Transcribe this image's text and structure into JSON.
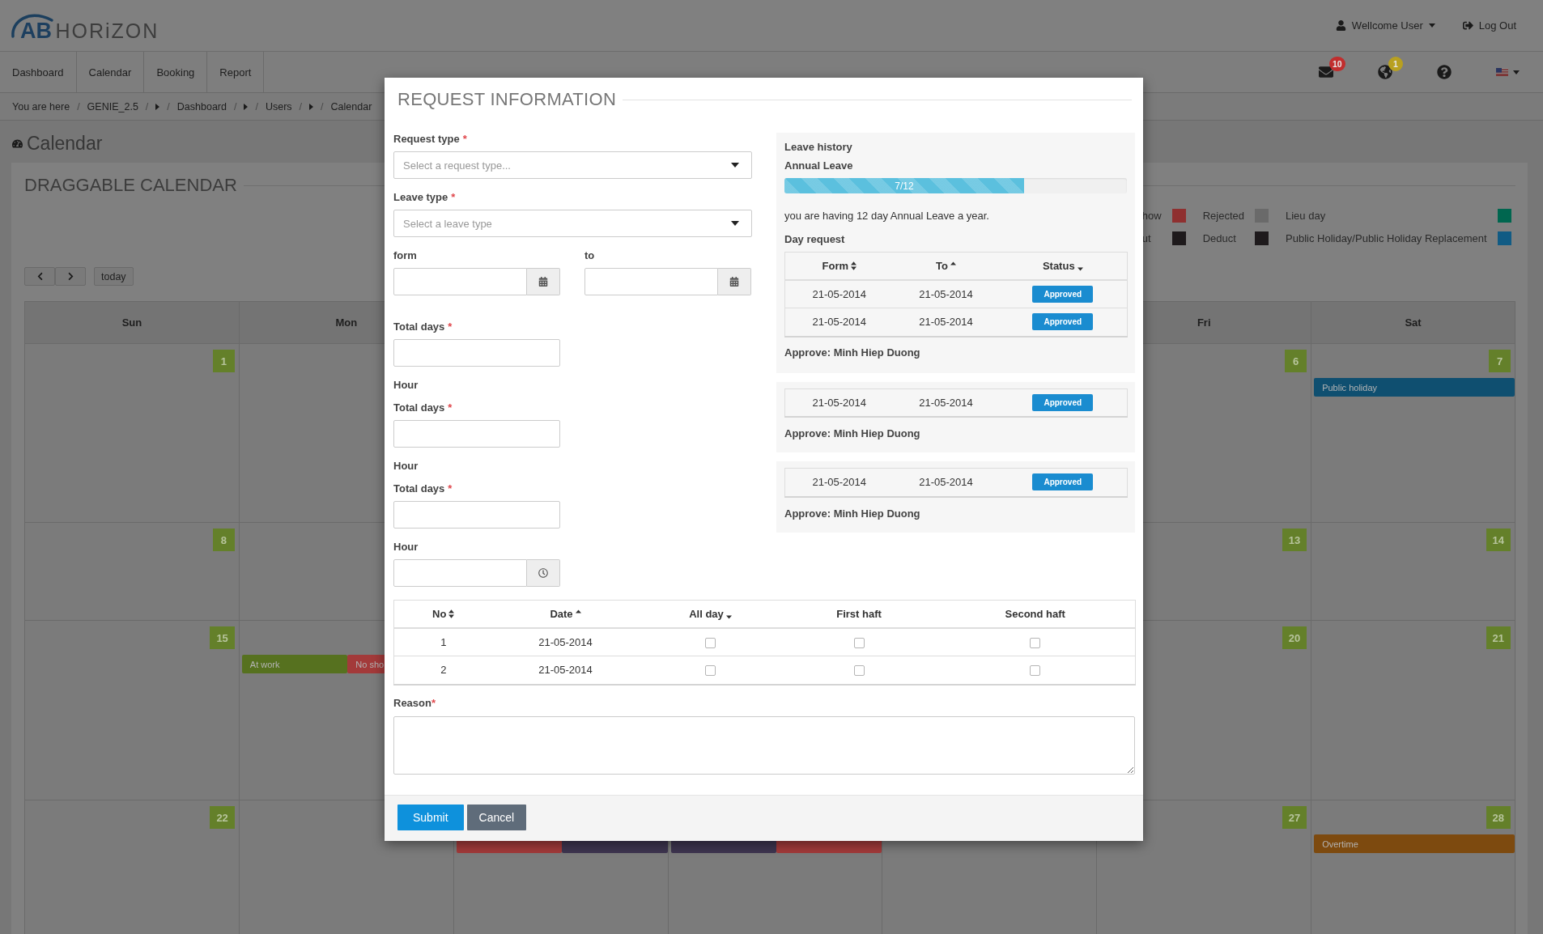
{
  "header": {
    "logo": {
      "mark": "AB",
      "name": "HORiZON"
    },
    "user_menu": "Wellcome User",
    "logout": "Log Out"
  },
  "nav": {
    "tabs": [
      {
        "label": "Dashboard",
        "selected": false
      },
      {
        "label": "Calendar",
        "selected": false
      },
      {
        "label": "Booking",
        "selected": false
      },
      {
        "label": "Report",
        "selected": false
      }
    ],
    "icons": [
      {
        "kind": "mail",
        "badge": "10",
        "color": "#c12e2e"
      },
      {
        "kind": "globe",
        "badge": "1",
        "color": "#b8a020"
      },
      {
        "kind": "help"
      },
      {
        "kind": "flag"
      }
    ]
  },
  "breadcrumb": [
    {
      "kind": "text",
      "text": "You are here"
    },
    {
      "kind": "separator",
      "text": "/"
    },
    {
      "kind": "link",
      "text": "GENIE_2.5"
    },
    {
      "kind": "separator",
      "text": "/"
    },
    {
      "kind": "caret"
    },
    {
      "kind": "separator",
      "text": "/"
    },
    {
      "kind": "link",
      "text": "Dashboard"
    },
    {
      "kind": "separator",
      "text": "/"
    },
    {
      "kind": "caret"
    },
    {
      "kind": "separator",
      "text": "/"
    },
    {
      "kind": "link",
      "text": "Users"
    },
    {
      "kind": "separator",
      "text": "/"
    },
    {
      "kind": "caret"
    },
    {
      "kind": "separator",
      "text": "/"
    },
    {
      "kind": "link",
      "text": "Calendar"
    }
  ],
  "page_title": "Calendar",
  "calendar": {
    "title": "DRAGGABLE CALENDAR",
    "legend": [
      {
        "label": "how",
        "color": "#8f3030"
      },
      {
        "label": "Rejected",
        "color": "#6a6a6a"
      },
      {
        "label": "Lieu day",
        "color": "#00664f"
      },
      {
        "label": "ut",
        "color": "#1e1a1c"
      },
      {
        "label": "Deduct",
        "color": "#1e1a1c"
      },
      {
        "label": "Public Holiday/Public Holiday Replacement",
        "color": "#115b84"
      }
    ],
    "today_button": "today",
    "weekdays": {
      "sun": "Sun",
      "mon": "Mon",
      "fri": "Fri",
      "sat": "Sat"
    },
    "weeks": [
      {
        "sun": {
          "day": "1"
        },
        "fri": {
          "day": "6"
        },
        "sat": {
          "day": "7",
          "events": [
            {
              "label": "Public holiday",
              "color": "#0f4f70"
            }
          ]
        }
      },
      {
        "sun": {
          "day": "8"
        },
        "fri": {
          "day": "13"
        },
        "sat": {
          "day": "14"
        }
      },
      {
        "sun": {
          "day": "15"
        },
        "mon": {
          "events": [
            {
              "label": "At work",
              "color": "#56711f"
            },
            {
              "label": "No sho",
              "color": "#a33a3a"
            }
          ]
        },
        "fri": {
          "day": "20"
        },
        "sat": {
          "day": "21"
        }
      },
      {
        "sun": {
          "day": "22"
        },
        "tue": {
          "events": [
            {
              "color": "#a33a3a"
            },
            {
              "color": "#3e3550"
            }
          ]
        },
        "wed": {
          "events": [
            {
              "color": "#3e3550"
            },
            {
              "color": "#a33a3a"
            }
          ]
        },
        "fri": {
          "day": "27"
        },
        "sat": {
          "day": "28",
          "events": [
            {
              "label": "Overtime",
              "color": "#7d4a0f"
            }
          ]
        }
      }
    ]
  },
  "dialog": {
    "title": "REQUEST INFORMATION",
    "fields": [
      {
        "kind": "select",
        "label": "Request type",
        "mark": "*",
        "placeholder": "Select a request type..."
      },
      {
        "kind": "select",
        "label": "Leave type",
        "mark": "*",
        "placeholder": "Select a leave type"
      },
      {
        "kind": "date_range",
        "from_label": "form",
        "to_label": "to"
      },
      {
        "kind": "number",
        "label": "Total days",
        "mark": "*"
      },
      {
        "kind": "caption",
        "label": "Hour"
      },
      {
        "kind": "number",
        "label": "Total days",
        "mark": "*"
      },
      {
        "kind": "caption",
        "label": "Hour"
      },
      {
        "kind": "number",
        "label": "Total days",
        "mark": "*"
      },
      {
        "kind": "time",
        "label": "Hour"
      }
    ],
    "history": {
      "title": "Leave history",
      "leave_type": "Annual Leave",
      "progress": {
        "label": "7/12",
        "level": 0.7
      },
      "note": "you are having 12 day Annual Leave a year.",
      "subtitle": "Day request",
      "columns": [
        {
          "label": "Form",
          "kind": "sort_both"
        },
        {
          "label": "To",
          "kind": "sort_up"
        },
        {
          "label": "Status",
          "kind": "sort_down"
        }
      ],
      "groups": [
        {
          "header": true,
          "rows": [
            {
              "from": "21-05-2014",
              "to": "21-05-2014",
              "status": "Approved"
            },
            {
              "from": "21-05-2014",
              "to": "21-05-2014",
              "status": "Approved"
            }
          ],
          "approver": "Approve: Minh Hiep Duong"
        },
        {
          "header": false,
          "rows": [
            {
              "from": "21-05-2014",
              "to": "21-05-2014",
              "status": "Approved"
            }
          ],
          "approver": "Approve: Minh Hiep Duong"
        },
        {
          "header": false,
          "rows": [
            {
              "from": "21-05-2014",
              "to": "21-05-2014",
              "status": "Approved"
            }
          ],
          "approver": "Approve: Minh Hiep Duong"
        }
      ]
    },
    "table": {
      "columns": [
        {
          "label": "No",
          "kind": "sort_both"
        },
        {
          "label": "Date",
          "kind": "sort_up"
        },
        {
          "label": "All day",
          "kind": "sort_down"
        },
        {
          "label": "First haft",
          "kind": "plain"
        },
        {
          "label": "Second haft",
          "kind": "plain"
        }
      ],
      "rows": [
        {
          "no": "1",
          "date": "21-05-2014",
          "all_day": false,
          "first_half": false,
          "second_half": false
        },
        {
          "no": "2",
          "date": "21-05-2014",
          "all_day": false,
          "first_half": false,
          "second_half": false
        }
      ]
    },
    "reason": {
      "label": "Reason",
      "mark": "*"
    },
    "buttons": [
      {
        "label": "Submit",
        "kind": "primary"
      },
      {
        "label": "Cancel",
        "kind": "secondary"
      }
    ]
  }
}
